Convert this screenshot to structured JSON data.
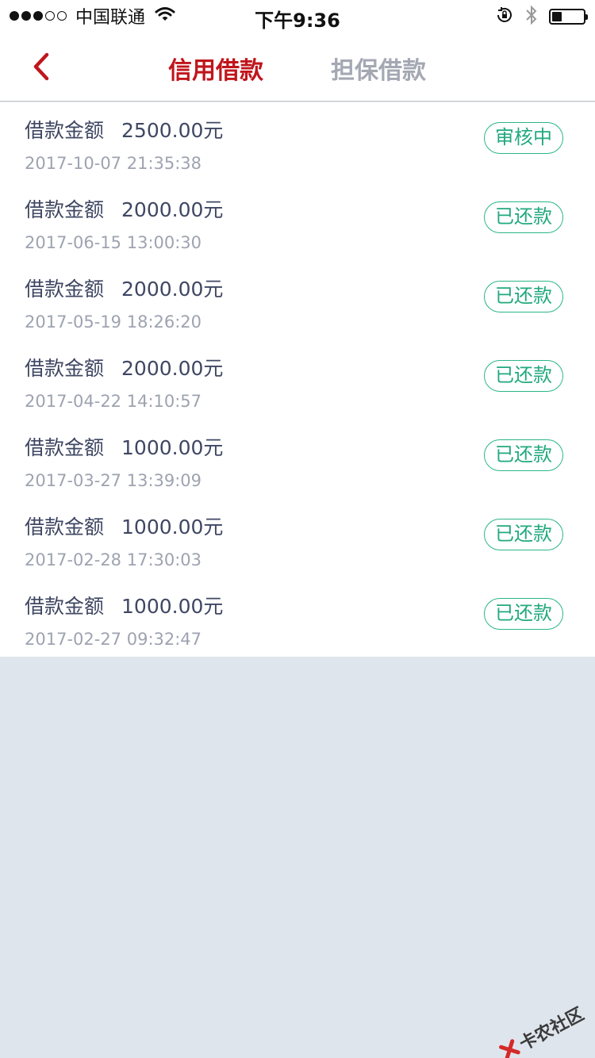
{
  "status_bar": {
    "signal_dots": [
      true,
      true,
      true,
      false,
      false
    ],
    "carrier": "中国联通",
    "time": "下午9:36"
  },
  "nav": {
    "tabs": [
      {
        "label": "信用借款",
        "active": true
      },
      {
        "label": "担保借款",
        "active": false
      }
    ]
  },
  "loans": [
    {
      "label": "借款金额",
      "amount": "2500.00元",
      "datetime": "2017-10-07 21:35:38",
      "status": "审核中"
    },
    {
      "label": "借款金额",
      "amount": "2000.00元",
      "datetime": "2017-06-15 13:00:30",
      "status": "已还款"
    },
    {
      "label": "借款金额",
      "amount": "2000.00元",
      "datetime": "2017-05-19 18:26:20",
      "status": "已还款"
    },
    {
      "label": "借款金额",
      "amount": "2000.00元",
      "datetime": "2017-04-22 14:10:57",
      "status": "已还款"
    },
    {
      "label": "借款金额",
      "amount": "1000.00元",
      "datetime": "2017-03-27 13:39:09",
      "status": "已还款"
    },
    {
      "label": "借款金额",
      "amount": "1000.00元",
      "datetime": "2017-02-28 17:30:03",
      "status": "已还款"
    },
    {
      "label": "借款金额",
      "amount": "1000.00元",
      "datetime": "2017-02-27 09:32:47",
      "status": "已还款"
    }
  ],
  "watermark": {
    "text": "卡农社区"
  },
  "colors": {
    "accent": "#c0151c",
    "status_green": "#22a97e",
    "background": "#dfe5ec"
  }
}
